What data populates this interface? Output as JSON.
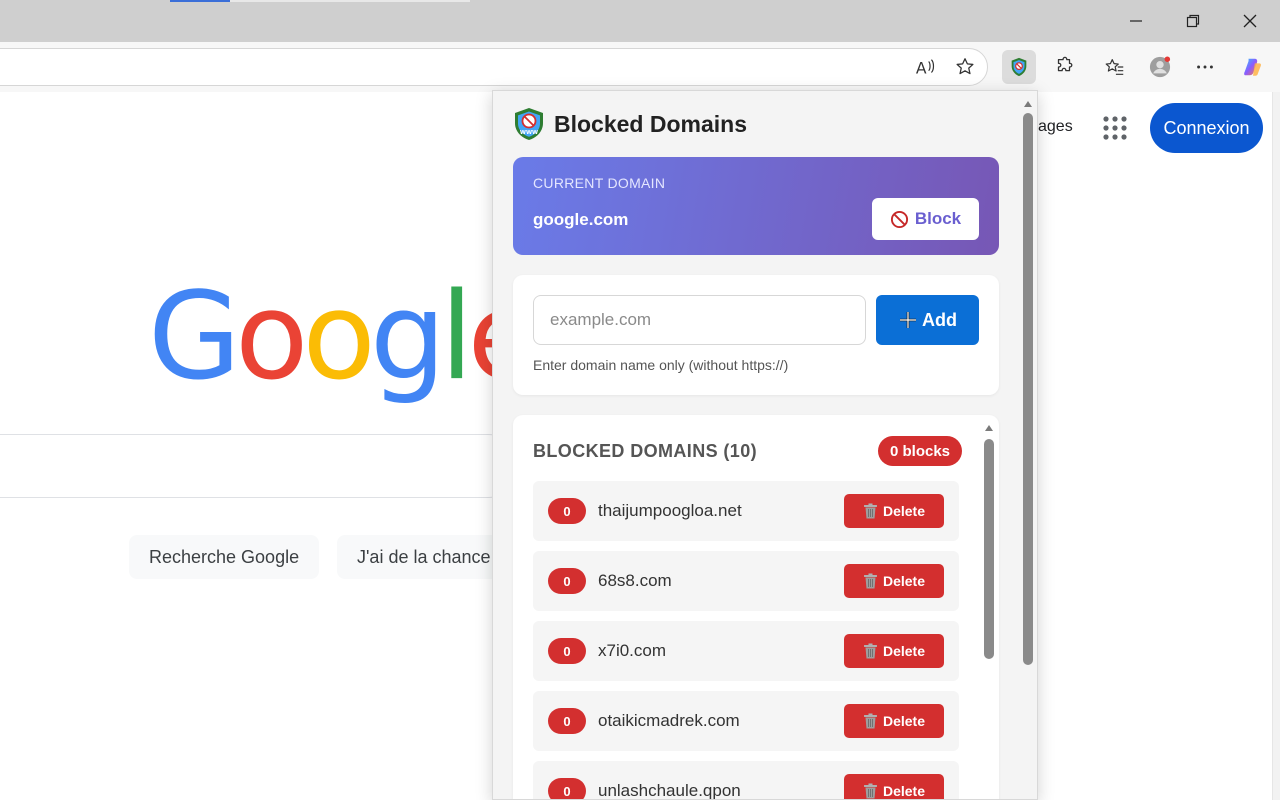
{
  "browser": {
    "window_controls": [
      "minimize",
      "restore",
      "close"
    ],
    "toolbar_icons": [
      "read-aloud-icon",
      "favorite-star-icon",
      "extension-shield-icon",
      "extensions-puzzle-icon",
      "favorites-list-icon",
      "profile-avatar-icon",
      "more-options-icon",
      "copilot-icon"
    ]
  },
  "google": {
    "logo": "Google",
    "images_link": "ages",
    "signin_button": "Connexion",
    "buttons": [
      "Recherche Google",
      "J'ai de la chance"
    ],
    "colors": {
      "blue": "#4285F4",
      "red": "#EA4335",
      "yellow": "#FBBC05",
      "green": "#34A853",
      "signin": "#0b57d0"
    }
  },
  "popup": {
    "title": "Blocked Domains",
    "current": {
      "label": "CURRENT DOMAIN",
      "domain": "google.com",
      "block_label": "Block"
    },
    "add": {
      "placeholder": "example.com",
      "button_label": "Add",
      "hint": "Enter domain name only (without https://)"
    },
    "list": {
      "title": "BLOCKED DOMAINS (10)",
      "badge": "0 blocks",
      "delete_label": "Delete",
      "items": [
        {
          "count": "0",
          "domain": "thaijumpoogloa.net"
        },
        {
          "count": "0",
          "domain": "68s8.com"
        },
        {
          "count": "0",
          "domain": "x7i0.com"
        },
        {
          "count": "0",
          "domain": "otaikicmadrek.com"
        },
        {
          "count": "0",
          "domain": "unlashchaule.qpon"
        }
      ]
    },
    "colors": {
      "gradient_start": "#6a7be8",
      "gradient_end": "#7757b5",
      "add_button": "#0b6fd6",
      "danger": "#d32f2f"
    }
  }
}
